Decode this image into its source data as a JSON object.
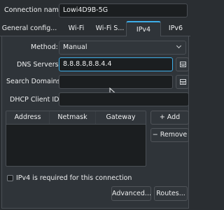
{
  "connection": {
    "name_label": "Connection name:",
    "name_value": "Lowi4D9B-5G"
  },
  "tabs": [
    {
      "label": "General config...",
      "active": false
    },
    {
      "label": "Wi-Fi",
      "active": false
    },
    {
      "label": "Wi-Fi S...",
      "active": false
    },
    {
      "label": "IPv4",
      "active": true
    },
    {
      "label": "IPv6",
      "active": false
    }
  ],
  "ipv4": {
    "method_label": "Method:",
    "method_value": "Manual",
    "dns_label": "DNS Servers:",
    "dns_value": "8.8.8.8,8.8.4.4",
    "search_label": "Search Domains:",
    "search_value": "",
    "dhcp_label": "DHCP Client ID:",
    "dhcp_value": ""
  },
  "address_table": {
    "columns": [
      "Address",
      "Netmask",
      "Gateway"
    ]
  },
  "buttons": {
    "add": "+ Add",
    "remove": "− Remove",
    "advanced": "Advanced...",
    "routes": "Routes..."
  },
  "required_label": "IPv4 is required for this connection",
  "colors": {
    "accent": "#3daee9",
    "background": "#2a2e32",
    "field": "#1b1e20"
  }
}
